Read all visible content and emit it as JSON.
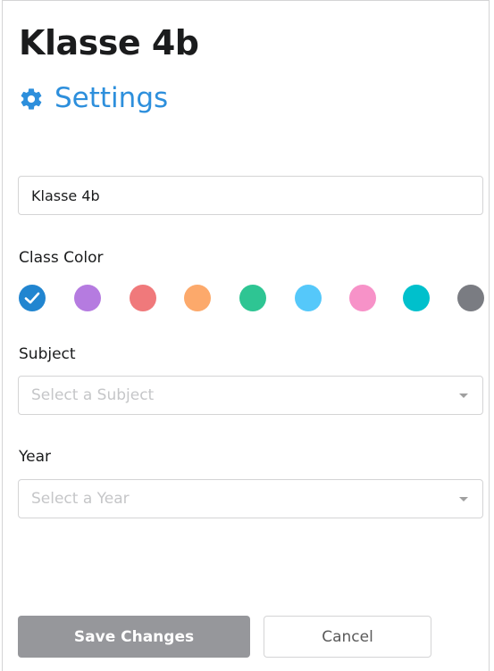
{
  "header": {
    "title": "Klasse 4b",
    "subtitle": "Settings"
  },
  "form": {
    "name_value": "Klasse 4b",
    "class_color_label": "Class Color",
    "colors": [
      {
        "name": "blue",
        "hex": "#2185d0",
        "selected": true
      },
      {
        "name": "purple",
        "hex": "#b57be0"
      },
      {
        "name": "red",
        "hex": "#f0797b"
      },
      {
        "name": "orange",
        "hex": "#fca96b"
      },
      {
        "name": "green",
        "hex": "#2ec593"
      },
      {
        "name": "light-blue",
        "hex": "#55c8fa"
      },
      {
        "name": "pink",
        "hex": "#f792c8"
      },
      {
        "name": "teal",
        "hex": "#00c0cc"
      },
      {
        "name": "grey",
        "hex": "#7a7c82"
      }
    ],
    "subject_label": "Subject",
    "subject_placeholder": "Select a Subject",
    "year_label": "Year",
    "year_placeholder": "Select a Year"
  },
  "actions": {
    "save_label": "Save Changes",
    "cancel_label": "Cancel"
  },
  "theme": {
    "accent": "#2d8fdc"
  }
}
